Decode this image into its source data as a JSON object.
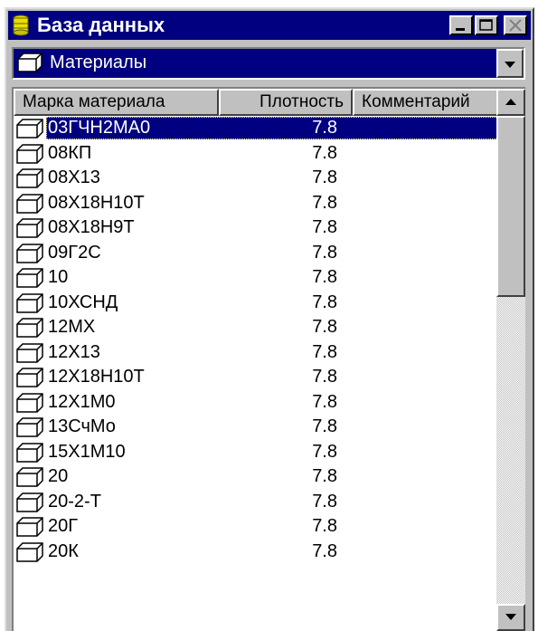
{
  "window": {
    "title": "База данных",
    "icon": "database-icon",
    "buttons": [
      "minimize-icon",
      "maximize-icon",
      "close-icon"
    ]
  },
  "combo": {
    "selected": "Материалы",
    "icon": "cube-icon"
  },
  "table": {
    "columns": [
      "Марка материала",
      "Плотность",
      "Комментарий"
    ],
    "selected_index": 0,
    "rows": [
      {
        "name": "03ГЧН2МА0",
        "density": "7.8",
        "comment": ""
      },
      {
        "name": "08КП",
        "density": "7.8",
        "comment": ""
      },
      {
        "name": "08Х13",
        "density": "7.8",
        "comment": ""
      },
      {
        "name": "08Х18Н10Т",
        "density": "7.8",
        "comment": ""
      },
      {
        "name": "08Х18Н9Т",
        "density": "7.8",
        "comment": ""
      },
      {
        "name": "09Г2С",
        "density": "7.8",
        "comment": ""
      },
      {
        "name": "10",
        "density": "7.8",
        "comment": ""
      },
      {
        "name": "10ХСНД",
        "density": "7.8",
        "comment": ""
      },
      {
        "name": "12МХ",
        "density": "7.8",
        "comment": ""
      },
      {
        "name": "12Х13",
        "density": "7.8",
        "comment": ""
      },
      {
        "name": "12Х18Н10Т",
        "density": "7.8",
        "comment": ""
      },
      {
        "name": "12Х1М0",
        "density": "7.8",
        "comment": ""
      },
      {
        "name": "13СчМо",
        "density": "7.8",
        "comment": ""
      },
      {
        "name": "15Х1М10",
        "density": "7.8",
        "comment": ""
      },
      {
        "name": "20",
        "density": "7.8",
        "comment": ""
      },
      {
        "name": "20-2-Т",
        "density": "7.8",
        "comment": ""
      },
      {
        "name": "20Г",
        "density": "7.8",
        "comment": ""
      },
      {
        "name": "20К",
        "density": "7.8",
        "comment": ""
      }
    ]
  },
  "colors": {
    "titlebar": "#000080",
    "selection": "#000080",
    "face": "#c0c0c0"
  }
}
